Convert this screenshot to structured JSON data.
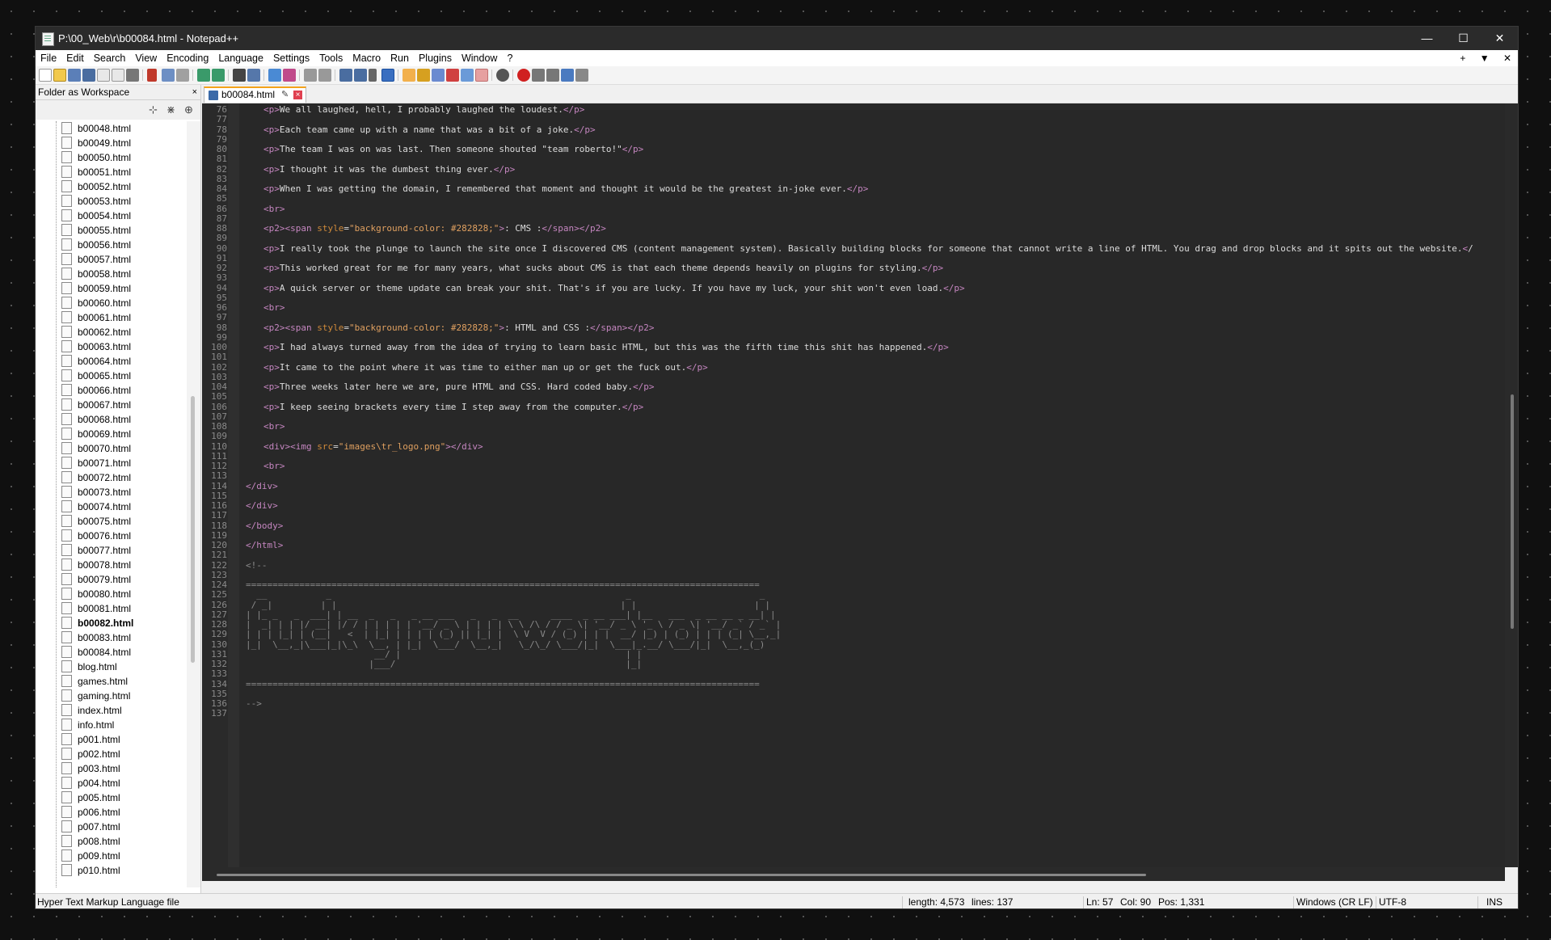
{
  "window": {
    "title": "P:\\00_Web\\r\\b00084.html - Notepad++",
    "minimize": "—",
    "maximize": "☐",
    "close": "✕"
  },
  "menu": [
    "File",
    "Edit",
    "Search",
    "View",
    "Encoding",
    "Language",
    "Settings",
    "Tools",
    "Macro",
    "Run",
    "Plugins",
    "Window",
    "?"
  ],
  "menu_right": [
    "+",
    "▼",
    "✕"
  ],
  "panel": {
    "title": "Folder as Workspace",
    "close": "×",
    "files": [
      "b00048.html",
      "b00049.html",
      "b00050.html",
      "b00051.html",
      "b00052.html",
      "b00053.html",
      "b00054.html",
      "b00055.html",
      "b00056.html",
      "b00057.html",
      "b00058.html",
      "b00059.html",
      "b00060.html",
      "b00061.html",
      "b00062.html",
      "b00063.html",
      "b00064.html",
      "b00065.html",
      "b00066.html",
      "b00067.html",
      "b00068.html",
      "b00069.html",
      "b00070.html",
      "b00071.html",
      "b00072.html",
      "b00073.html",
      "b00074.html",
      "b00075.html",
      "b00076.html",
      "b00077.html",
      "b00078.html",
      "b00079.html",
      "b00080.html",
      "b00081.html",
      "b00082.html",
      "b00083.html",
      "b00084.html",
      "blog.html",
      "games.html",
      "gaming.html",
      "index.html",
      "info.html",
      "p001.html",
      "p002.html",
      "p003.html",
      "p004.html",
      "p005.html",
      "p006.html",
      "p007.html",
      "p008.html",
      "p009.html",
      "p010.html"
    ],
    "selected_file": "b00082.html"
  },
  "tab": {
    "label": "b00084.html"
  },
  "editor": {
    "first_line": 76,
    "lines": [
      "<p>We all laughed, hell, I probably laughed the loudest.</p>",
      "",
      "<p>Each team came up with a name that was a bit of a joke.</p>",
      "",
      "<p>The team I was on was last. Then someone shouted \"team roberto!\"</p>",
      "",
      "<p>I thought it was the dumbest thing ever.</p>",
      "",
      "<p>When I was getting the domain, I remembered that moment and thought it would be the greatest in-joke ever.</p>",
      "",
      "<br>",
      "",
      "<p2><span style=\"background-color: #282828;\">: CMS :</span></p2>",
      "",
      "<p>I really took the plunge to launch the site once I discovered CMS (content management system). Basically building blocks for someone that cannot write a line of HTML. You drag and drop blocks and it spits out the website.</",
      "",
      "<p>This worked great for me for many years, what sucks about CMS is that each theme depends heavily on plugins for styling.</p>",
      "",
      "<p>A quick server or theme update can break your shit. That's if you are lucky. If you have my luck, your shit won't even load.</p>",
      "",
      "<br>",
      "",
      "<p2><span style=\"background-color: #282828;\">: HTML and CSS :</span></p2>",
      "",
      "<p>I had always turned away from the idea of trying to learn basic HTML, but this was the fifth time this shit has happened.</p>",
      "",
      "<p>It came to the point where it was time to either man up or get the fuck out.</p>",
      "",
      "<p>Three weeks later here we are, pure HTML and CSS. Hard coded baby.</p>",
      "",
      "<p>I keep seeing brackets every time I step away from the computer.</p>",
      "",
      "<br>",
      "",
      "<div><img src=\"images\\tr_logo.png\"></div>",
      "",
      "<br>",
      "",
      "</div>",
      "",
      "</div>",
      "",
      "</body>",
      "",
      "</html>",
      "",
      "<!--",
      "",
      "================================================================================================",
      "  __           _                                                       _                        _",
      " / _|         | |                                                     | |                      | |",
      "| |_ _   _  ___| | __  _   _   _ __ ___   _   _  __      ____  _ __ ___| |__   ___  _ __ __ _ __| |",
      "|  _| | | |/ __| |/ / | | | | | '__/ _ \\ | | | | \\ \\ /\\ / / _ \\| '__/ _ \\ '_ \\ / _ \\| '__/ _` / _` |",
      "| | | |_| | (__|   <  | |_| | | | | (_) || |_| |  \\ V  V / (_) | | |  __/ |_) | (_) | | | (_| \\__,_|",
      "|_|  \\__,_|\\___|_|\\_\\  \\__, | |_|  \\___/  \\__,_|   \\_/\\_/ \\___/|_|  \\___|_.__/ \\___/|_|  \\__,_(_)",
      "                        __/ |                                          | |",
      "                       |___/                                           |_|",
      "",
      "================================================================================================",
      "",
      "-->",
      ""
    ]
  },
  "status": {
    "file_type": "Hyper Text Markup Language file",
    "length": "length: 4,573",
    "lines": "lines: 137",
    "ln": "Ln: 57",
    "col": "Col: 90",
    "pos": "Pos: 1,331",
    "eol": "Windows (CR LF)",
    "encoding": "UTF-8",
    "mode": "INS"
  }
}
